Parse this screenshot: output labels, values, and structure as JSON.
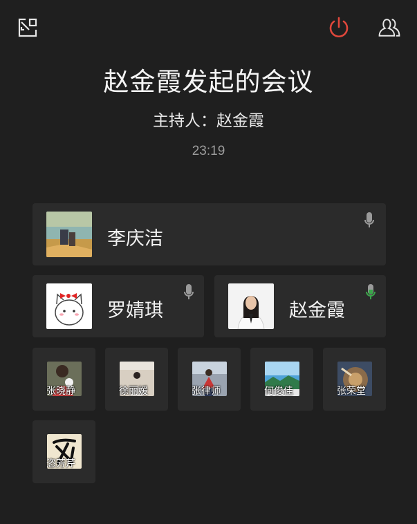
{
  "header": {
    "title": "赵金霞发起的会议",
    "host": "主持人：赵金霞",
    "timer": "23:19",
    "hangup_color": "#e0473b"
  },
  "large_participants": [
    {
      "name": "李庆洁",
      "mic": "inactive"
    },
    {
      "name": "罗婧琪",
      "mic": "inactive"
    },
    {
      "name": "赵金霞",
      "mic": "active"
    }
  ],
  "small_participants": [
    {
      "name": "张晓静"
    },
    {
      "name": "徐丽媛"
    },
    {
      "name": "张律师"
    },
    {
      "name": "何俊佳"
    },
    {
      "name": "张荣堂"
    },
    {
      "name": "恣芳芹"
    }
  ],
  "colors": {
    "background": "#1f1f1f",
    "card": "#2b2b2b",
    "mic_active": "#3aa54a",
    "mic_inactive": "#9a9a9a"
  }
}
